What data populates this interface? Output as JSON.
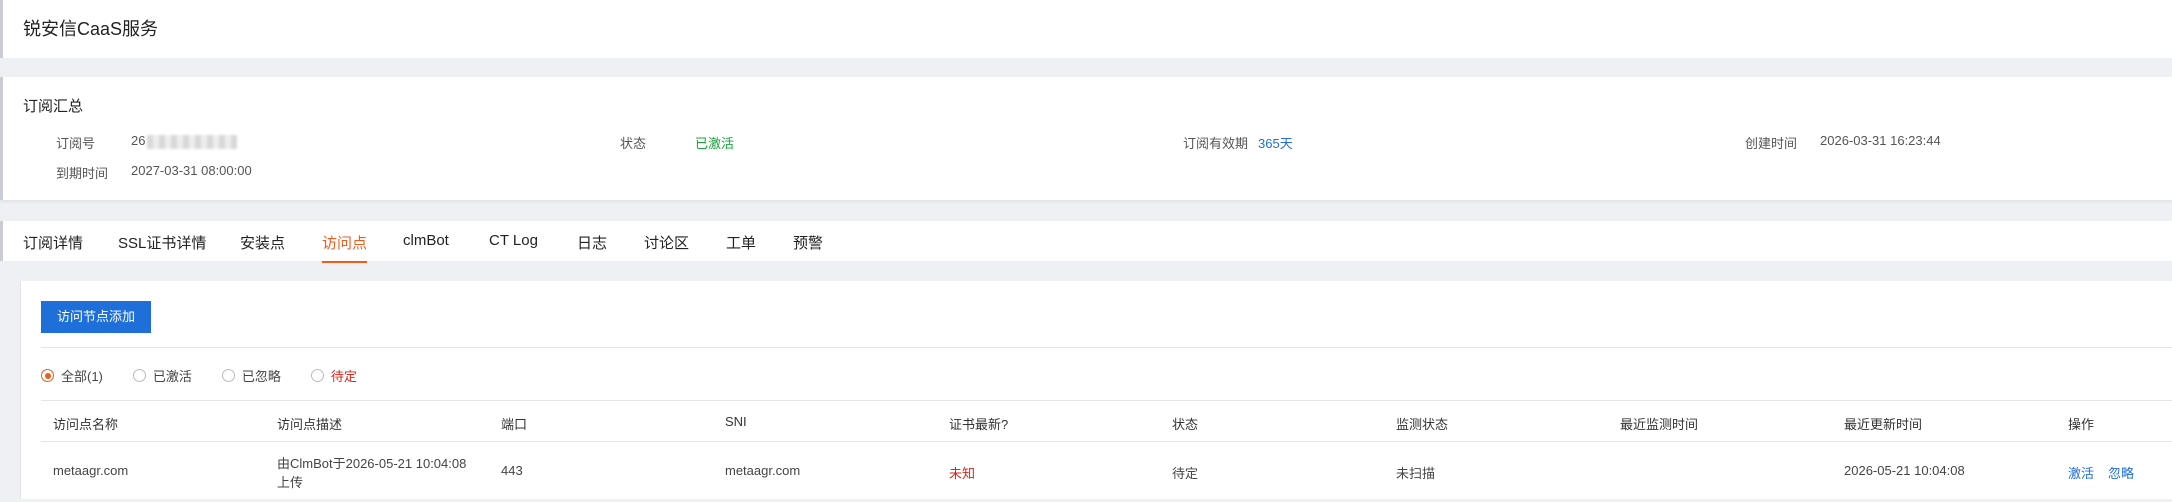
{
  "app_title": "锐安信CaaS服务",
  "summary": {
    "title": "订阅汇总",
    "order_label": "订阅号",
    "order_value": "26",
    "status_label": "状态",
    "status_value": "已激活",
    "validity_label": "订阅有效期",
    "validity_value": "365天",
    "created_label": "创建时间",
    "created_value": "2026-03-31 16:23:44",
    "expire_label": "到期时间",
    "expire_value": "2027-03-31 08:00:00"
  },
  "tabs": [
    "订阅详情",
    "SSL证书详情",
    "安装点",
    "访问点",
    "clmBot",
    "CT Log",
    "日志",
    "讨论区",
    "工单",
    "预警"
  ],
  "active_tab": "访问点",
  "toolbar": {
    "add_label": "访问节点添加"
  },
  "filters": [
    "全部(1)",
    "已激活",
    "已忽略",
    "待定"
  ],
  "table": {
    "headers": [
      "访问点名称",
      "访问点描述",
      "端口",
      "SNI",
      "证书最新?",
      "状态",
      "监测状态",
      "最近监测时间",
      "最近更新时间",
      "操作"
    ],
    "rows": [
      {
        "name": "metaagr.com",
        "desc": "由ClmBot于2026-05-21 10:04:08上传",
        "port": "443",
        "sni": "metaagr.com",
        "cert_latest": "未知",
        "status": "待定",
        "monitor_status": "未扫描",
        "last_monitor": "",
        "last_update": "2026-05-21 10:04:08",
        "actions": [
          "激活",
          "忽略"
        ]
      }
    ]
  },
  "colors": {
    "accent": "#ef5b1d",
    "primary": "#1e6fd9",
    "success": "#1aa33a",
    "danger": "#d9261c"
  }
}
